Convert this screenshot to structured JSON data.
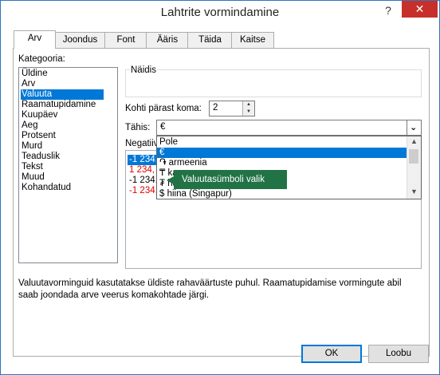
{
  "window": {
    "title": "Lahtrite vormindamine",
    "help_glyph": "?",
    "close_glyph": "✕"
  },
  "tabs": [
    "Arv",
    "Joondus",
    "Font",
    "Ääris",
    "Täida",
    "Kaitse"
  ],
  "categories": {
    "label": "Kategooria:",
    "items": [
      "Üldine",
      "Arv",
      "Valuuta",
      "Raamatupidamine",
      "Kuupäev",
      "Aeg",
      "Protsent",
      "Murd",
      "Teaduslik",
      "Tekst",
      "Muud",
      "Kohandatud"
    ],
    "selected": "Valuuta"
  },
  "sample": {
    "label": "Näidis"
  },
  "decimals": {
    "label": "Kohti pärast koma:",
    "value": "2"
  },
  "symbol": {
    "label": "Tähis:",
    "value": "€",
    "options": [
      "Pole",
      "€",
      "֏ armeenia",
      "₸ ka",
      "₮ ha",
      "$ hiina (Singapur)"
    ]
  },
  "negative": {
    "label": "Negatiiv",
    "items": [
      "-1 234,",
      "1 234,",
      "-1 234,",
      "-1 234,"
    ]
  },
  "tooltip": {
    "text": "Valuutasümboli valik"
  },
  "description": "Valuutavorminguid kasutatakse üldiste rahaväärtuste puhul. Raamatupidamise vormingute abil saab joondada arve veerus komakohtade järgi.",
  "buttons": {
    "ok": "OK",
    "cancel": "Loobu"
  }
}
